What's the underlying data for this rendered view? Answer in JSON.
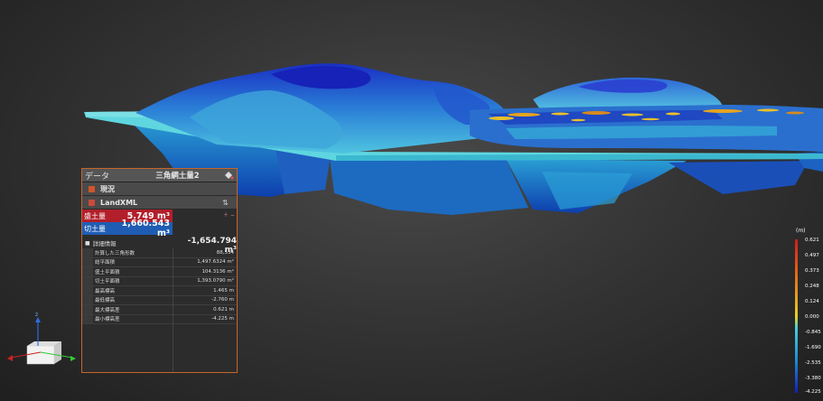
{
  "panel": {
    "label": "データ",
    "title": "三角網土量2",
    "rows": [
      {
        "text": "現況",
        "color": "#d2552a"
      },
      {
        "text": "LandXML",
        "color": "#cc4a3a"
      }
    ],
    "fill": {
      "label": "盛土量",
      "value": "5.749 m³"
    },
    "cut": {
      "label": "切土量",
      "value": "1,660.543 m³"
    },
    "net": "-1,654.794 m³",
    "detail_header": "詳細情報",
    "details": [
      {
        "k": "計算した三角形数",
        "v": "88,534"
      },
      {
        "k": "総平面積",
        "v": "1,497.6324 m²"
      },
      {
        "k": "盛土平面積",
        "v": "104.3136 m²"
      },
      {
        "k": "切土平面積",
        "v": "1,393.0790 m²"
      },
      {
        "k": "最高標高",
        "v": "1.465 m"
      },
      {
        "k": "最低標高",
        "v": "-2.760 m"
      },
      {
        "k": "最大標高差",
        "v": "0.621 m"
      },
      {
        "k": "最小標高差",
        "v": "-4.225 m"
      }
    ]
  },
  "legend": {
    "unit": "(m)",
    "labels": [
      "0.621",
      "0.497",
      "0.373",
      "0.248",
      "0.124",
      "0.000",
      "-0.845",
      "-1.690",
      "-2.535",
      "-3.380",
      "-4.225"
    ]
  },
  "axis": {
    "labels": [
      "z",
      "x",
      "y"
    ]
  }
}
